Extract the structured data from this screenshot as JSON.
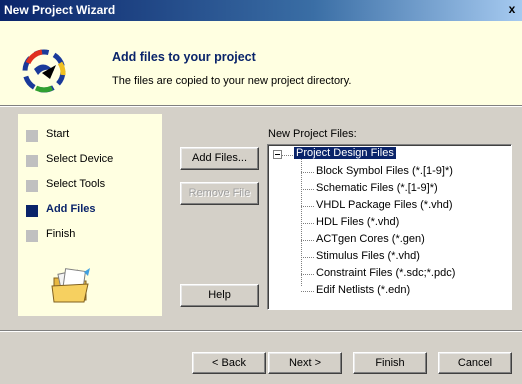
{
  "window": {
    "title": "New Project Wizard",
    "close_glyph": "x"
  },
  "header": {
    "title": "Add files to your project",
    "subtitle": "The files are copied to your new project directory."
  },
  "steps": [
    {
      "label": "Start",
      "current": false
    },
    {
      "label": "Select Device",
      "current": false
    },
    {
      "label": "Select Tools",
      "current": false
    },
    {
      "label": "Add Files",
      "current": true
    },
    {
      "label": "Finish",
      "current": false
    }
  ],
  "buttons": {
    "add_files": "Add Files...",
    "remove_file": "Remove File",
    "help": "Help",
    "back": "< Back",
    "next": "Next >",
    "finish": "Finish",
    "cancel": "Cancel"
  },
  "file_list": {
    "label": "New Project Files:",
    "root": "Project Design Files",
    "items": [
      "Block Symbol Files (*.[1-9]*)",
      "Schematic Files (*.[1-9]*)",
      "VHDL Package Files (*.vhd)",
      "HDL Files (*.vhd)",
      "ACTgen Cores (*.gen)",
      "Stimulus Files (*.vhd)",
      "Constraint Files (*.sdc;*.pdc)",
      "Edif Netlists (*.edn)"
    ]
  },
  "colors": {
    "accent": "#0a246a",
    "panel": "#ffffe1",
    "chrome": "#d4d0c8"
  },
  "icons": {
    "wizard_logo": "wizard-logo-icon",
    "folder": "open-folder-icon"
  }
}
